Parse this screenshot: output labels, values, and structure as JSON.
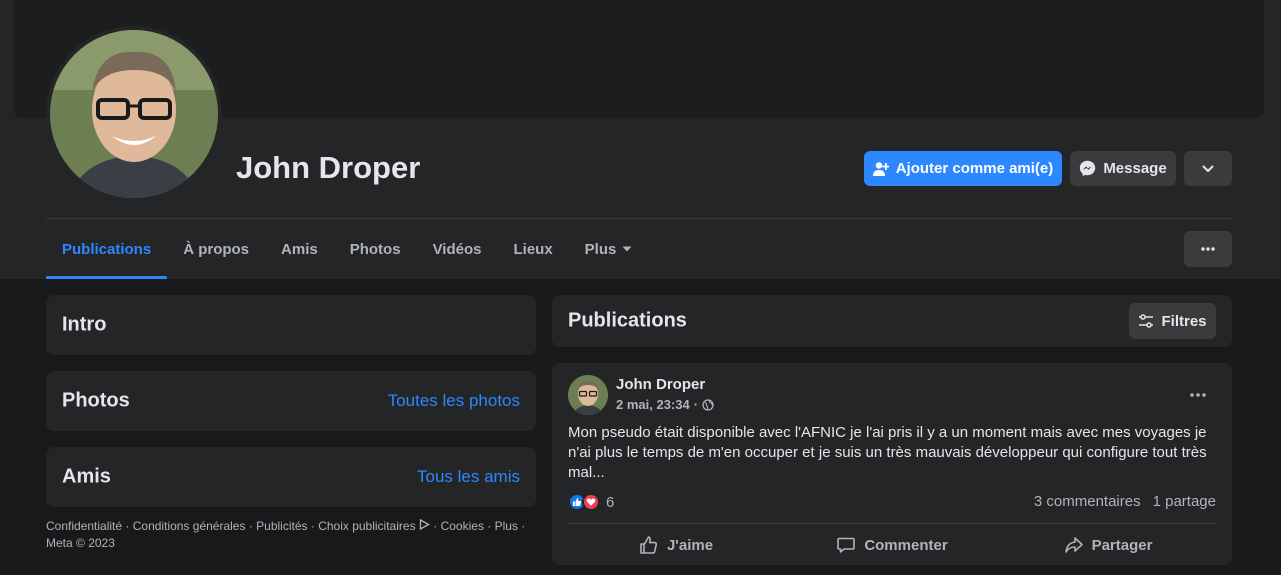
{
  "colors": {
    "accent": "#2d88ff",
    "surface": "#242526",
    "background": "#18191a",
    "like": "#1b74e4",
    "love": "#f33e58"
  },
  "profile": {
    "name": "John Droper",
    "add_friend_label": "Ajouter comme ami(e)",
    "message_label": "Message"
  },
  "tabs": [
    {
      "label": "Publications",
      "active": true
    },
    {
      "label": "À propos"
    },
    {
      "label": "Amis"
    },
    {
      "label": "Photos"
    },
    {
      "label": "Vidéos"
    },
    {
      "label": "Lieux"
    },
    {
      "label": "Plus"
    }
  ],
  "sidebar": {
    "intro_title": "Intro",
    "photos_title": "Photos",
    "photos_link": "Toutes les photos",
    "friends_title": "Amis",
    "friends_link": "Tous les amis"
  },
  "footer": {
    "privacy": "Confidentialité",
    "terms": "Conditions générales",
    "ads": "Publicités",
    "ad_choices": "Choix publicitaires",
    "cookies": "Cookies",
    "more": "Plus",
    "copyright": "Meta © 2023"
  },
  "publications": {
    "title": "Publications",
    "filters_label": "Filtres"
  },
  "post": {
    "author": "John Droper",
    "timestamp": "2 mai, 23:34",
    "text": "Mon pseudo était disponible avec l'AFNIC je l'ai pris il y a un moment mais avec mes voyages je n'ai plus le temps de m'en occuper et je suis un très mauvais développeur qui configure tout très mal...",
    "reaction_count": "6",
    "comments": "3 commentaires",
    "shares": "1 partage",
    "like_label": "J'aime",
    "comment_label": "Commenter",
    "share_label": "Partager"
  }
}
